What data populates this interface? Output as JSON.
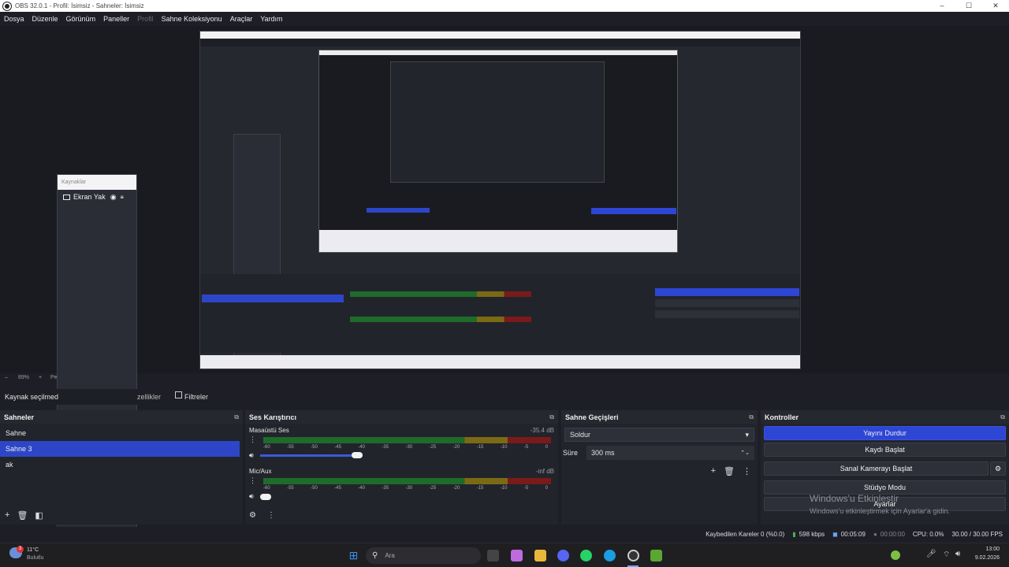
{
  "window": {
    "title": "OBS 32.0.1 - Profil: İsimsiz - Sahneler: İsimsiz",
    "minimize": "–",
    "maximize": "☐",
    "close": "✕"
  },
  "menu": [
    "Dosya",
    "Düzenle",
    "Görünüm",
    "Paneller",
    "Profil",
    "Sahne Koleksiyonu",
    "Araçlar",
    "Yardım"
  ],
  "float_sources": {
    "header": "Kaynaklar",
    "source_name": "Ekran Yak"
  },
  "zoom": {
    "level": "89%",
    "minus": "–",
    "plus": "+",
    "partial": "Pe"
  },
  "source_toolbar": {
    "selection": "Kaynak seçilmed",
    "properties": "zellikler",
    "filters": "Filtreler"
  },
  "scenes": {
    "title": "Sahneler",
    "items": [
      "Sahne",
      "Sahne 3",
      "ak"
    ],
    "selected": 1
  },
  "mixer": {
    "title": "Ses Karıştırıcı",
    "tracks": [
      {
        "name": "Masaüstü Ses",
        "db": "-35.4 dB"
      },
      {
        "name": "Mic/Aux",
        "db": "-inf dB"
      }
    ],
    "ticks": [
      "-60",
      "-55",
      "-50",
      "-45",
      "-40",
      "-35",
      "-30",
      "-25",
      "-20",
      "-15",
      "-10",
      "-5",
      "0"
    ]
  },
  "transitions": {
    "title": "Sahne Geçişleri",
    "selected": "Soldur",
    "duration_label": "Süre",
    "duration_value": "300 ms"
  },
  "controls": {
    "title": "Kontroller",
    "stop_stream": "Yayını Durdur",
    "start_record": "Kaydı Başlat",
    "virtual_cam": "Sanal Kamerayı Başlat",
    "studio_mode": "Stüdyo Modu",
    "settings": "Ayarlar"
  },
  "watermark": {
    "line1": "Windows'u Etkinleştir",
    "line2": "Windows'u etkinleştirmek için Ayarlar'a gidin."
  },
  "status": {
    "dropped": "Kaybedilen Kareler 0 (%0.0)",
    "bitrate": "598 kbps",
    "stream_time": "00:05:09",
    "rec_time": "00:00:00",
    "cpu": "CPU: 0.0%",
    "fps": "30.00 / 30.00 FPS"
  },
  "taskbar": {
    "weather_temp": "11°C",
    "weather_desc": "Bulutlu",
    "weather_badge": "3",
    "search": "Ara",
    "time": "13:00",
    "date": "9.02.2026"
  },
  "colors": {
    "accent": "#2e46d4",
    "selected": "#2d46c8",
    "bg": "#1e1f26"
  }
}
